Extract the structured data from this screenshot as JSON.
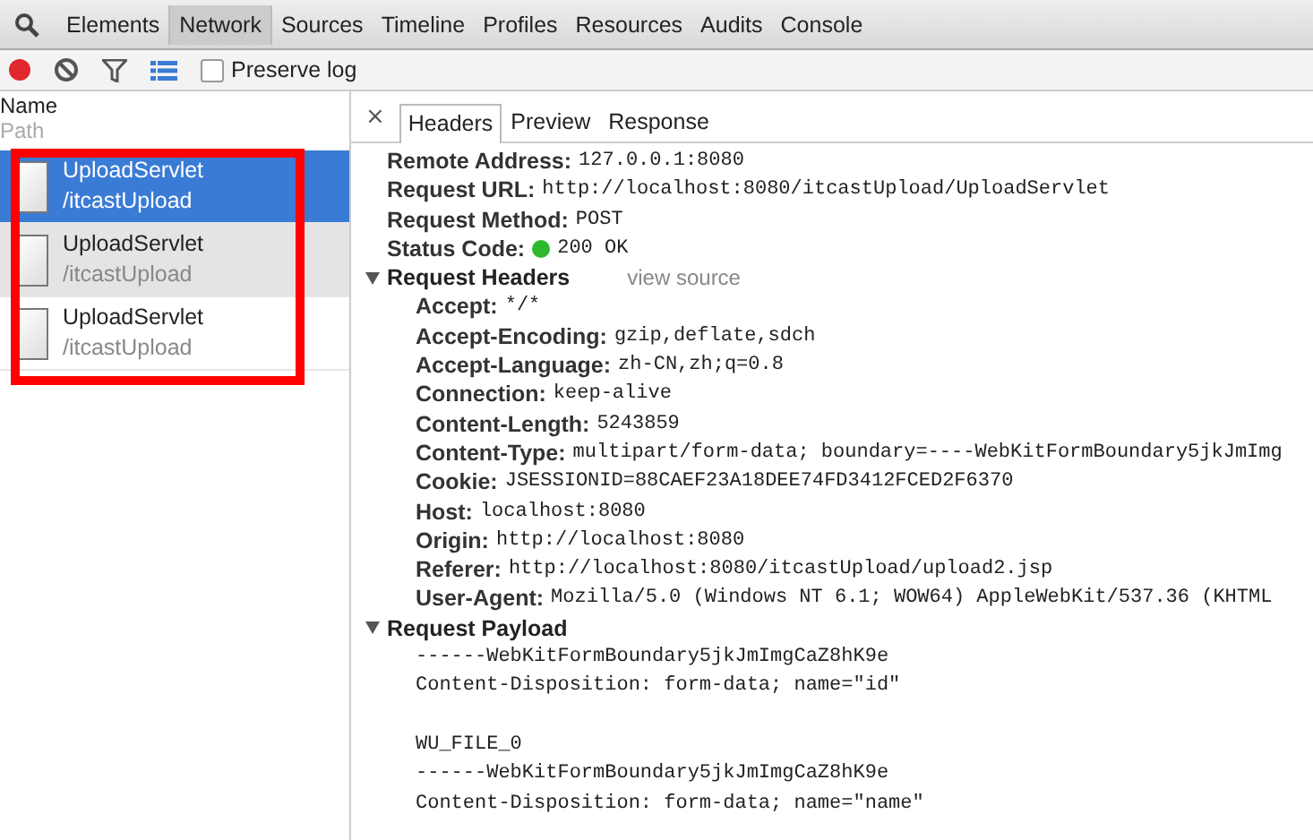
{
  "panel_tabs": [
    {
      "label": "Elements",
      "selected": false
    },
    {
      "label": "Network",
      "selected": true
    },
    {
      "label": "Sources",
      "selected": false
    },
    {
      "label": "Timeline",
      "selected": false
    },
    {
      "label": "Profiles",
      "selected": false
    },
    {
      "label": "Resources",
      "selected": false
    },
    {
      "label": "Audits",
      "selected": false
    },
    {
      "label": "Console",
      "selected": false
    }
  ],
  "toolbar": {
    "recording": true,
    "preserve_log": {
      "label": "Preserve log",
      "checked": false
    }
  },
  "request_list": {
    "header": {
      "name": "Name",
      "path": "Path"
    },
    "highlighted": true,
    "rows": [
      {
        "name": "UploadServlet",
        "path": "/itcastUpload",
        "selected": true,
        "hovered": false
      },
      {
        "name": "UploadServlet",
        "path": "/itcastUpload",
        "selected": false,
        "hovered": true
      },
      {
        "name": "UploadServlet",
        "path": "/itcastUpload",
        "selected": false,
        "hovered": false
      }
    ]
  },
  "detail_tabs": {
    "close": "×",
    "tabs": [
      {
        "label": "Headers",
        "selected": true
      },
      {
        "label": "Preview",
        "selected": false
      },
      {
        "label": "Response",
        "selected": false
      }
    ]
  },
  "general": [
    {
      "label": "Remote Address:",
      "value": "127.0.0.1:8080",
      "kind": "plain"
    },
    {
      "label": "Request URL:",
      "value": "http://localhost:8080/itcastUpload/UploadServlet",
      "kind": "plain"
    },
    {
      "label": "Request Method:",
      "value": "POST",
      "kind": "plain"
    },
    {
      "label": "Status Code:",
      "value": "200 OK",
      "kind": "status",
      "color": "#2eb82e"
    }
  ],
  "sections": [
    {
      "title": "Request Headers",
      "expanded": true,
      "link": "view source",
      "kind": "headers",
      "items": [
        {
          "label": "Accept:",
          "value": "*/*"
        },
        {
          "label": "Accept-Encoding:",
          "value": "gzip,deflate,sdch"
        },
        {
          "label": "Accept-Language:",
          "value": "zh-CN,zh;q=0.8"
        },
        {
          "label": "Connection:",
          "value": "keep-alive"
        },
        {
          "label": "Content-Length:",
          "value": "5243859"
        },
        {
          "label": "Content-Type:",
          "value": "multipart/form-data; boundary=----WebKitFormBoundary5jkJmImg"
        },
        {
          "label": "Cookie:",
          "value": "JSESSIONID=88CAEF23A18DEE74FD3412FCED2F6370"
        },
        {
          "label": "Host:",
          "value": "localhost:8080"
        },
        {
          "label": "Origin:",
          "value": "http://localhost:8080"
        },
        {
          "label": "Referer:",
          "value": "http://localhost:8080/itcastUpload/upload2.jsp"
        },
        {
          "label": "User-Agent:",
          "value": "Mozilla/5.0 (Windows NT 6.1; WOW64) AppleWebKit/537.36 (KHTML"
        }
      ]
    },
    {
      "title": "Request Payload",
      "expanded": true,
      "kind": "payload",
      "blocks": [
        [
          "------WebKitFormBoundary5jkJmImgCaZ8hK9e",
          "Content-Disposition: form-data; name=\"id\""
        ],
        [
          "WU_FILE_0",
          "------WebKitFormBoundary5jkJmImgCaZ8hK9e",
          "Content-Disposition: form-data; name=\"name\""
        ]
      ]
    }
  ]
}
